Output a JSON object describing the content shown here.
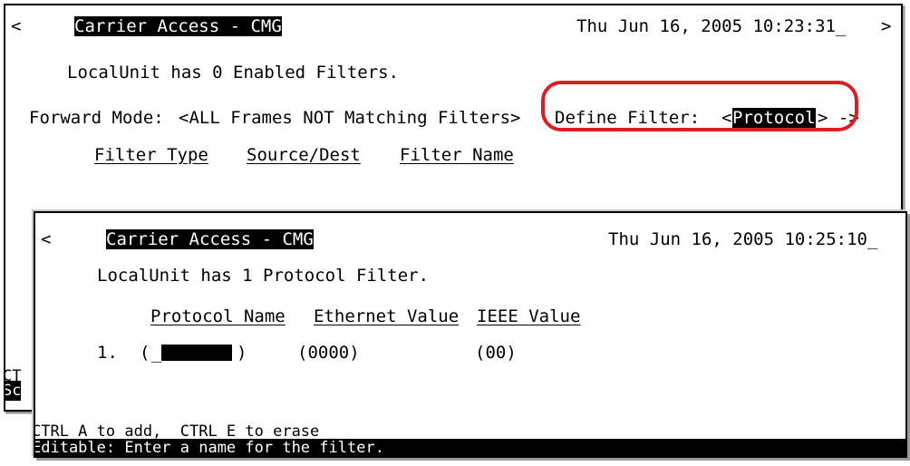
{
  "back": {
    "nav_left": "<",
    "nav_right": ">",
    "title": "Carrier Access - CMG",
    "datetime": "Thu Jun 16, 2005 10:23:31_",
    "status_line": "LocalUnit has 0 Enabled Filters.",
    "forward_label": "Forward Mode:",
    "forward_value": "<ALL Frames NOT Matching Filters>",
    "define_label": "Define Filter:",
    "define_open": "<",
    "define_value": "Protocol",
    "define_close": "> ->",
    "col_filter_type": "Filter Type",
    "col_source_dest": "Source/Dest",
    "col_filter_name": "Filter Name",
    "hidden_line1": "CT",
    "hidden_line2": "Sc"
  },
  "front": {
    "nav_left": "<",
    "title": "Carrier Access - CMG",
    "datetime": "Thu Jun 16, 2005 10:25:10_",
    "status_line": "LocalUnit has 1 Protocol Filter.",
    "columns": [
      "Protocol Name",
      "Ethernet Value",
      "IEEE Value"
    ],
    "row": {
      "index": "1.",
      "name_open": "(",
      "name_value": "_",
      "name_close": ")",
      "ethernet": "(0000)",
      "ieee": "(00)"
    },
    "help_line": "CTRL A to add,  CTRL E to erase",
    "status_bar": "Editable: Enter a name for the filter."
  },
  "colors": {
    "highlight_ring": "#e01c24",
    "terminal_bg": "#ffffff",
    "terminal_fg": "#000000"
  }
}
